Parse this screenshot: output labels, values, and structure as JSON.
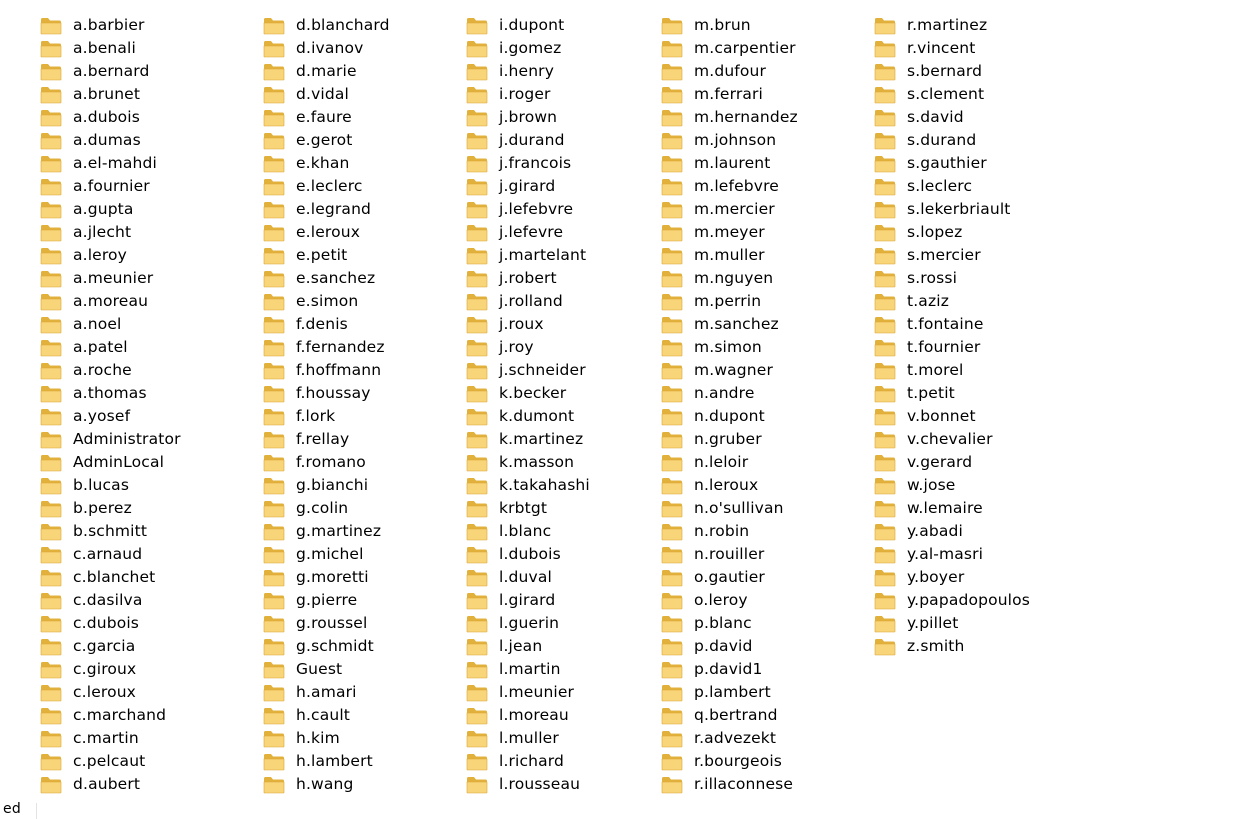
{
  "items": [
    "a.barbier",
    "a.benali",
    "a.bernard",
    "a.brunet",
    "a.dubois",
    "a.dumas",
    "a.el-mahdi",
    "a.fournier",
    "a.gupta",
    "a.jlecht",
    "a.leroy",
    "a.meunier",
    "a.moreau",
    "a.noel",
    "a.patel",
    "a.roche",
    "a.thomas",
    "a.yosef",
    "Administrator",
    "AdminLocal",
    "b.lucas",
    "b.perez",
    "b.schmitt",
    "c.arnaud",
    "c.blanchet",
    "c.dasilva",
    "c.dubois",
    "c.garcia",
    "c.giroux",
    "c.leroux",
    "c.marchand",
    "c.martin",
    "c.pelcaut",
    "d.aubert",
    "d.blanchard",
    "d.ivanov",
    "d.marie",
    "d.vidal",
    "e.faure",
    "e.gerot",
    "e.khan",
    "e.leclerc",
    "e.legrand",
    "e.leroux",
    "e.petit",
    "e.sanchez",
    "e.simon",
    "f.denis",
    "f.fernandez",
    "f.hoffmann",
    "f.houssay",
    "f.lork",
    "f.rellay",
    "f.romano",
    "g.bianchi",
    "g.colin",
    "g.martinez",
    "g.michel",
    "g.moretti",
    "g.pierre",
    "g.roussel",
    "g.schmidt",
    "Guest",
    "h.amari",
    "h.cault",
    "h.kim",
    "h.lambert",
    "h.wang",
    "i.dupont",
    "i.gomez",
    "i.henry",
    "i.roger",
    "j.brown",
    "j.durand",
    "j.francois",
    "j.girard",
    "j.lefebvre",
    "j.lefevre",
    "j.martelant",
    "j.robert",
    "j.rolland",
    "j.roux",
    "j.roy",
    "j.schneider",
    "k.becker",
    "k.dumont",
    "k.martinez",
    "k.masson",
    "k.takahashi",
    "krbtgt",
    "l.blanc",
    "l.dubois",
    "l.duval",
    "l.girard",
    "l.guerin",
    "l.jean",
    "l.martin",
    "l.meunier",
    "l.moreau",
    "l.muller",
    "l.richard",
    "l.rousseau",
    "m.brun",
    "m.carpentier",
    "m.dufour",
    "m.ferrari",
    "m.hernandez",
    "m.johnson",
    "m.laurent",
    "m.lefebvre",
    "m.mercier",
    "m.meyer",
    "m.muller",
    "m.nguyen",
    "m.perrin",
    "m.sanchez",
    "m.simon",
    "m.wagner",
    "n.andre",
    "n.dupont",
    "n.gruber",
    "n.leloir",
    "n.leroux",
    "n.o'sullivan",
    "n.robin",
    "n.rouiller",
    "o.gautier",
    "o.leroy",
    "p.blanc",
    "p.david",
    "p.david1",
    "p.lambert",
    "q.bertrand",
    "r.advezekt",
    "r.bourgeois",
    "r.illaconnese",
    "r.martinez",
    "r.vincent",
    "s.bernard",
    "s.clement",
    "s.david",
    "s.durand",
    "s.gauthier",
    "s.leclerc",
    "s.lekerbriault",
    "s.lopez",
    "s.mercier",
    "s.rossi",
    "t.aziz",
    "t.fontaine",
    "t.fournier",
    "t.morel",
    "t.petit",
    "v.bonnet",
    "v.chevalier",
    "v.gerard",
    "w.jose",
    "w.lemaire",
    "y.abadi",
    "y.al-masri",
    "y.boyer",
    "y.papadopoulos",
    "y.pillet",
    "z.smith"
  ],
  "status_bar": {
    "text": "ed"
  },
  "colors": {
    "folder_back": "#e2b13c",
    "folder_front": "#f9d57a",
    "folder_edge": "#d9a430",
    "label": "#000000"
  },
  "icon": "folder-icon"
}
